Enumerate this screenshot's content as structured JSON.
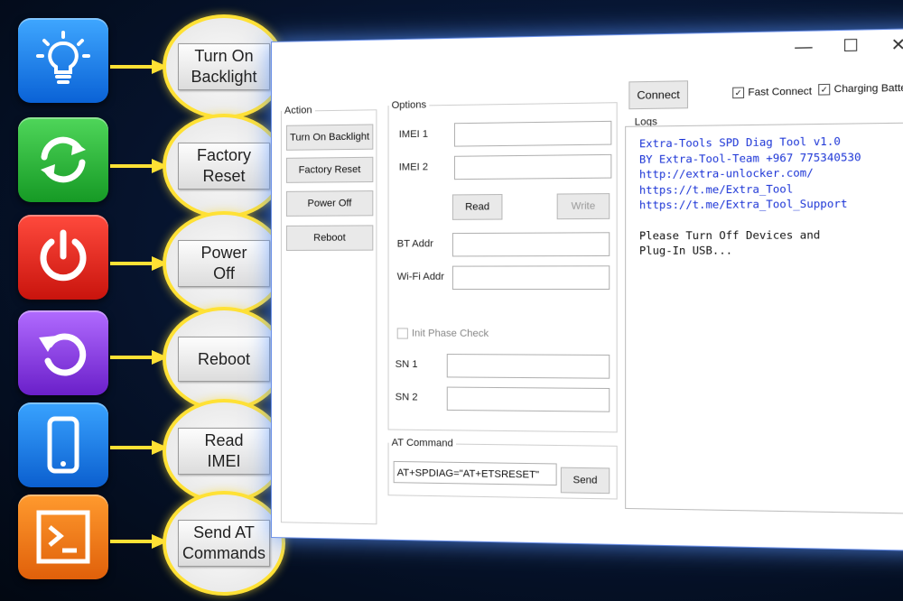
{
  "callouts": [
    {
      "label_line1": "Turn On",
      "label_line2": "Backlight",
      "icon": "lightbulb-icon",
      "color": "#1577e8"
    },
    {
      "label_line1": "Factory",
      "label_line2": "Reset",
      "icon": "sync-icon",
      "color": "#22a830"
    },
    {
      "label_line1": "Power",
      "label_line2": "Off",
      "icon": "power-icon",
      "color": "#e0261c"
    },
    {
      "label_line1": "Reboot",
      "label_line2": "",
      "icon": "refresh-icon",
      "color": "#8a3be0"
    },
    {
      "label_line1": "Read",
      "label_line2": "IMEI",
      "icon": "phone-icon",
      "color": "#1577e8"
    },
    {
      "label_line1": "Send AT",
      "label_line2": "Commands",
      "icon": "terminal-icon",
      "color": "#f07a16"
    }
  ],
  "window": {
    "controls": {
      "minimize": "—",
      "maximize": "☐",
      "close": "✕"
    },
    "action": {
      "legend": "Action",
      "buttons": [
        "Turn On Backlight",
        "Factory Reset",
        "Power Off",
        "Reboot"
      ]
    },
    "options": {
      "legend": "Options",
      "imei1": "IMEI 1",
      "imei2": "IMEI 2",
      "read": "Read",
      "write": "Write",
      "bt": "BT Addr",
      "wifi": "Wi-Fi Addr",
      "init_phase": "Init Phase Check",
      "sn1": "SN 1",
      "sn2": "SN 2"
    },
    "at": {
      "legend": "AT Command",
      "value": "AT+SPDIAG=\"AT+ETSRESET\"",
      "send": "Send"
    },
    "top": {
      "connect": "Connect",
      "fast_connect": "Fast Connect",
      "charging": "Charging Battery"
    },
    "logs": {
      "legend": "Logs",
      "lines_blue": [
        "Extra-Tools SPD Diag Tool v1.0",
        "BY Extra-Tool-Team +967 775340530",
        "http://extra-unlocker.com/",
        "https://t.me/Extra_Tool",
        "https://t.me/Extra_Tool_Support"
      ],
      "lines_black": [
        "Please Turn Off Devices and",
        "Plug-In USB..."
      ]
    }
  }
}
